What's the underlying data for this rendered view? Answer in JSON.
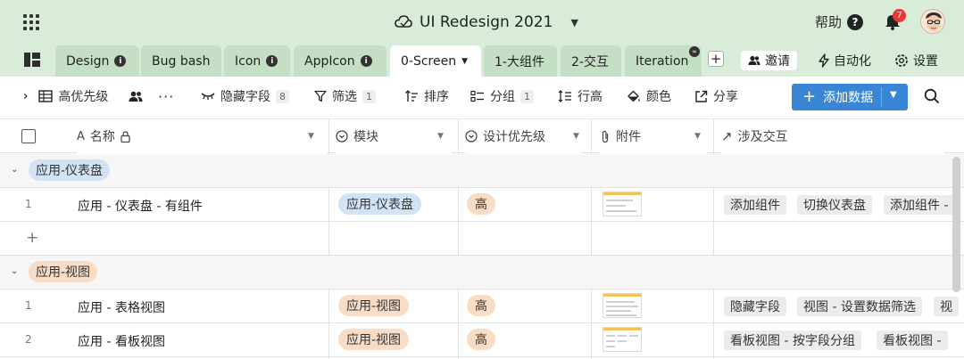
{
  "header": {
    "title": "UI Redesign 2021",
    "help_label": "帮助",
    "help_icon_text": "?",
    "notification_count": "7"
  },
  "tabs": [
    {
      "label": "Design"
    },
    {
      "label": "Bug bash"
    },
    {
      "label": "Icon"
    },
    {
      "label": "AppIcon"
    },
    {
      "label": "0-Screen"
    },
    {
      "label": "1-大组件"
    },
    {
      "label": "2-交互"
    },
    {
      "label": "Iteration"
    }
  ],
  "top_actions": {
    "invite": "邀请",
    "automation": "自动化",
    "settings": "设置"
  },
  "toolbar": {
    "view_name": "高优先级",
    "hide_fields": "隐藏字段",
    "hide_fields_count": "8",
    "filter": "筛选",
    "filter_count": "1",
    "sort": "排序",
    "group": "分组",
    "group_count": "1",
    "row_height": "行高",
    "color": "颜色",
    "share": "分享",
    "add_record": "添加数据"
  },
  "columns": {
    "name": "名称",
    "module": "模块",
    "priority": "设计优先级",
    "attachment": "附件",
    "interaction": "涉及交互"
  },
  "groups": [
    {
      "label": "应用-仪表盘",
      "rows": [
        {
          "num": "1",
          "name": "应用 - 仪表盘 - 有组件",
          "module": "应用-仪表盘",
          "priority": "高",
          "tags": [
            "添加组件",
            "切换仪表盘",
            "添加组件 -"
          ]
        }
      ]
    },
    {
      "label": "应用-视图",
      "rows": [
        {
          "num": "1",
          "name": "应用 - 表格视图",
          "module": "应用-视图",
          "priority": "高",
          "tags": [
            "隐藏字段",
            "视图 - 设置数据筛选",
            "视"
          ]
        },
        {
          "num": "2",
          "name": "应用 - 看板视图",
          "module": "应用-视图",
          "priority": "高",
          "tags": [
            "看板视图 - 按字段分组",
            "看板视图 -"
          ]
        }
      ]
    }
  ],
  "add_row_symbol": "+",
  "colors": {
    "topbar": "#d9ecd9",
    "tab_inactive": "#c5dfc5",
    "primary_button": "#3a86d6",
    "chip_blue": "#d3e3f6",
    "chip_orange": "#f8dcc6",
    "priority_high": "#f9dcc4"
  }
}
